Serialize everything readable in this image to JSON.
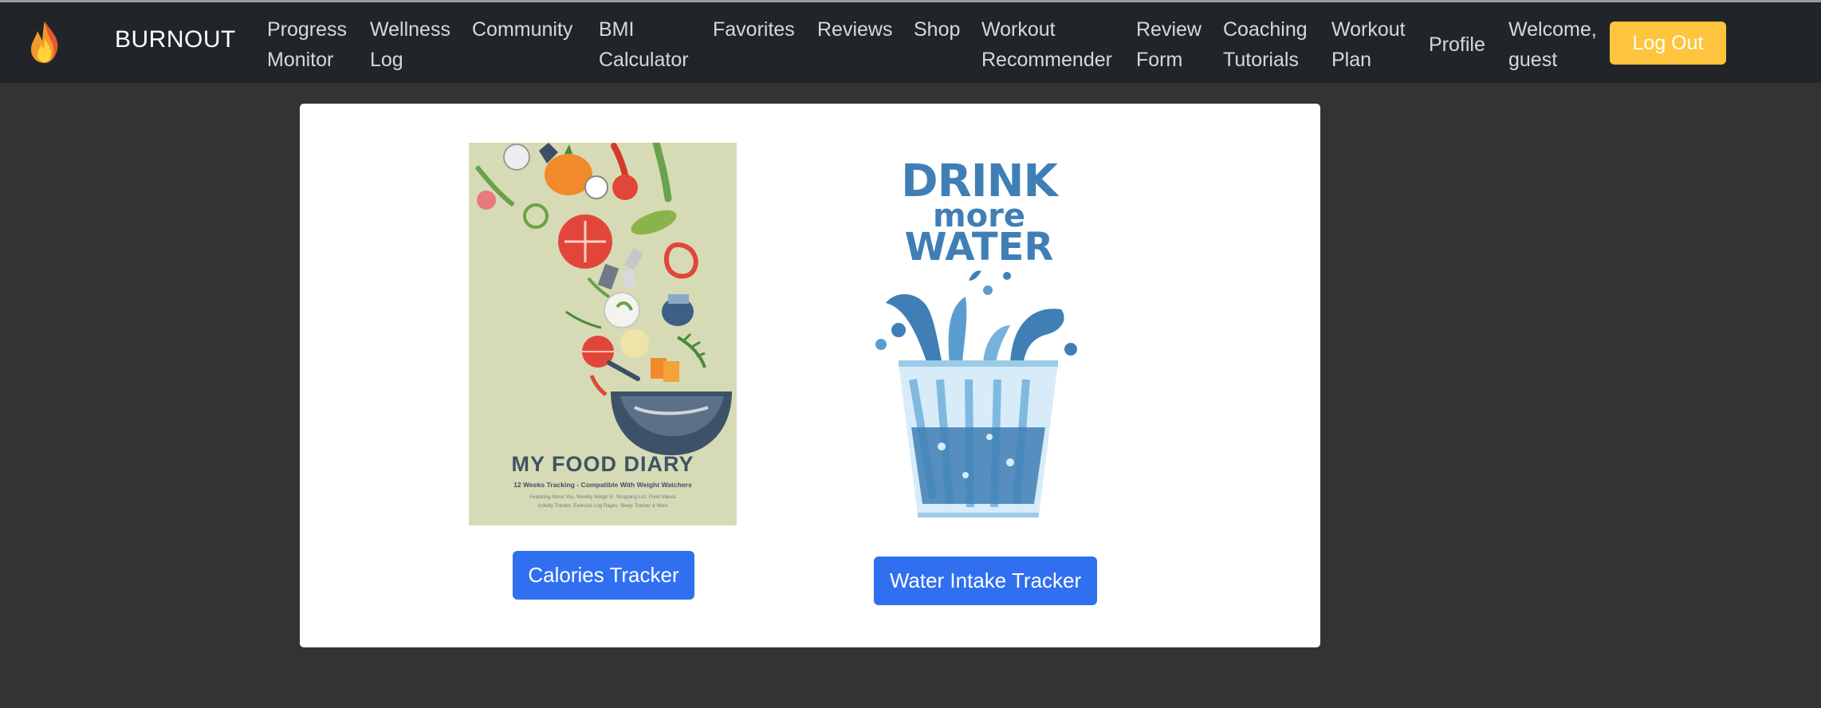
{
  "nav": {
    "brand": "BURNOUT",
    "links": [
      {
        "line1": "Progress",
        "line2": "Monitor"
      },
      {
        "line1": "Wellness",
        "line2": "Log"
      },
      {
        "line1": "Community",
        "line2": ""
      },
      {
        "line1": "BMI",
        "line2": "Calculator"
      },
      {
        "line1": "Favorites",
        "line2": ""
      },
      {
        "line1": "Reviews",
        "line2": ""
      },
      {
        "line1": "Shop",
        "line2": ""
      },
      {
        "line1": "Workout",
        "line2": "Recommender"
      },
      {
        "line1": "Review",
        "line2": "Form"
      },
      {
        "line1": "Coaching",
        "line2": "Tutorials"
      },
      {
        "line1": "Workout",
        "line2": "Plan"
      },
      {
        "line1": "Profile",
        "line2": ""
      }
    ],
    "welcome": {
      "line1": "Welcome,",
      "line2": "guest"
    },
    "logout_label": "Log Out"
  },
  "trackers": {
    "food": {
      "cover_title": "MY FOOD DIARY",
      "cover_subtitle": "12 Weeks Tracking - Compatible With Weight Watchers",
      "cover_fine_1": "Featuring About You, Weekly Weigh In, Shopping List, Food Values",
      "cover_fine_2": "Activity Tracker, Exercise Log Pages, Sleep Tracker & More",
      "button_label": "Calories Tracker"
    },
    "water": {
      "poster_line1": "DRINK",
      "poster_line2": "more",
      "poster_line3": "WATER",
      "button_label": "Water Intake Tracker"
    }
  },
  "colors": {
    "page_bg": "#333333",
    "navbar_bg": "#212529",
    "logout_bg": "#ffc43d",
    "primary_button": "#2f6ff0",
    "cover_bg": "#d6dbb5",
    "water_blue": "#3f7fb5"
  },
  "icons": {
    "logo": "fire-icon"
  }
}
